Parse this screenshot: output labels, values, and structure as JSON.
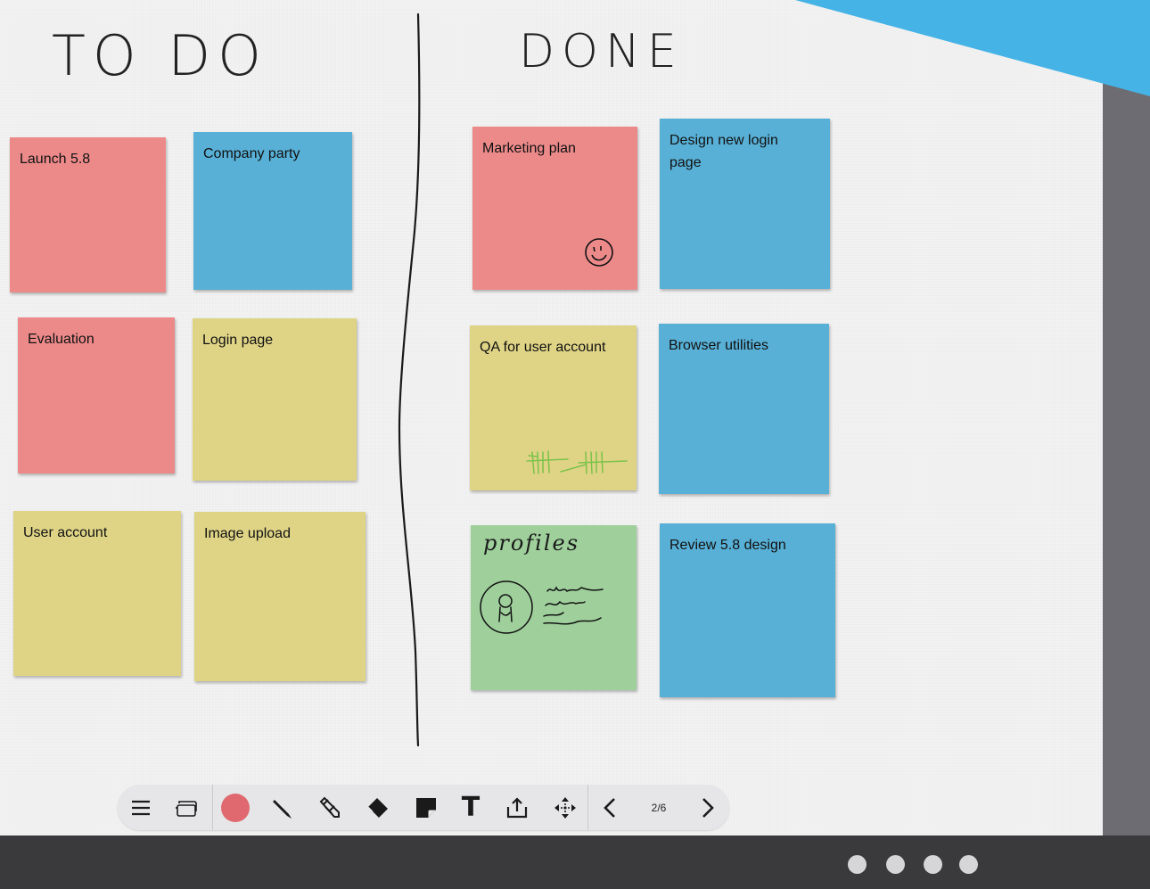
{
  "board": {
    "headings": {
      "todo": "TO DO",
      "done": "DONE"
    },
    "todo_notes": [
      {
        "label": "Launch 5.8",
        "color": "red"
      },
      {
        "label": "Company party",
        "color": "blue"
      },
      {
        "label": "Evaluation",
        "color": "red"
      },
      {
        "label": "Login page",
        "color": "yellow"
      },
      {
        "label": "User account",
        "color": "yellow"
      },
      {
        "label": "Image upload",
        "color": "yellow"
      }
    ],
    "done_notes": [
      {
        "label": "Marketing plan",
        "color": "red",
        "doodle": "smiley"
      },
      {
        "label": "Design new login page",
        "color": "blue"
      },
      {
        "label": "QA for user account",
        "color": "yellow",
        "doodle": "tally-marks"
      },
      {
        "label": "Browser utilities",
        "color": "blue"
      },
      {
        "label": "profiles",
        "color": "green",
        "doodle": "profile-sketch",
        "handwritten": true
      },
      {
        "label": "Review 5.8 design",
        "color": "blue"
      }
    ],
    "colors": {
      "red": "#ec8a8a",
      "blue": "#58b0d6",
      "yellow": "#dfd486",
      "green": "#9fd09c",
      "accent_banner": "#45b3e6",
      "tally_ink": "#7cc24a"
    }
  },
  "toolbar": {
    "tools": [
      "menu-icon",
      "pages-icon",
      "color-picker",
      "pen-icon",
      "marker-icon",
      "eraser-icon",
      "sticky-note-icon",
      "text-icon",
      "share-icon",
      "move-icon",
      "previous-page-icon",
      "next-page-icon"
    ],
    "current_color": "#e0696f",
    "text_tool_label": "T",
    "page_indicator": "2/6"
  },
  "pager": {
    "dot_count": 4
  }
}
